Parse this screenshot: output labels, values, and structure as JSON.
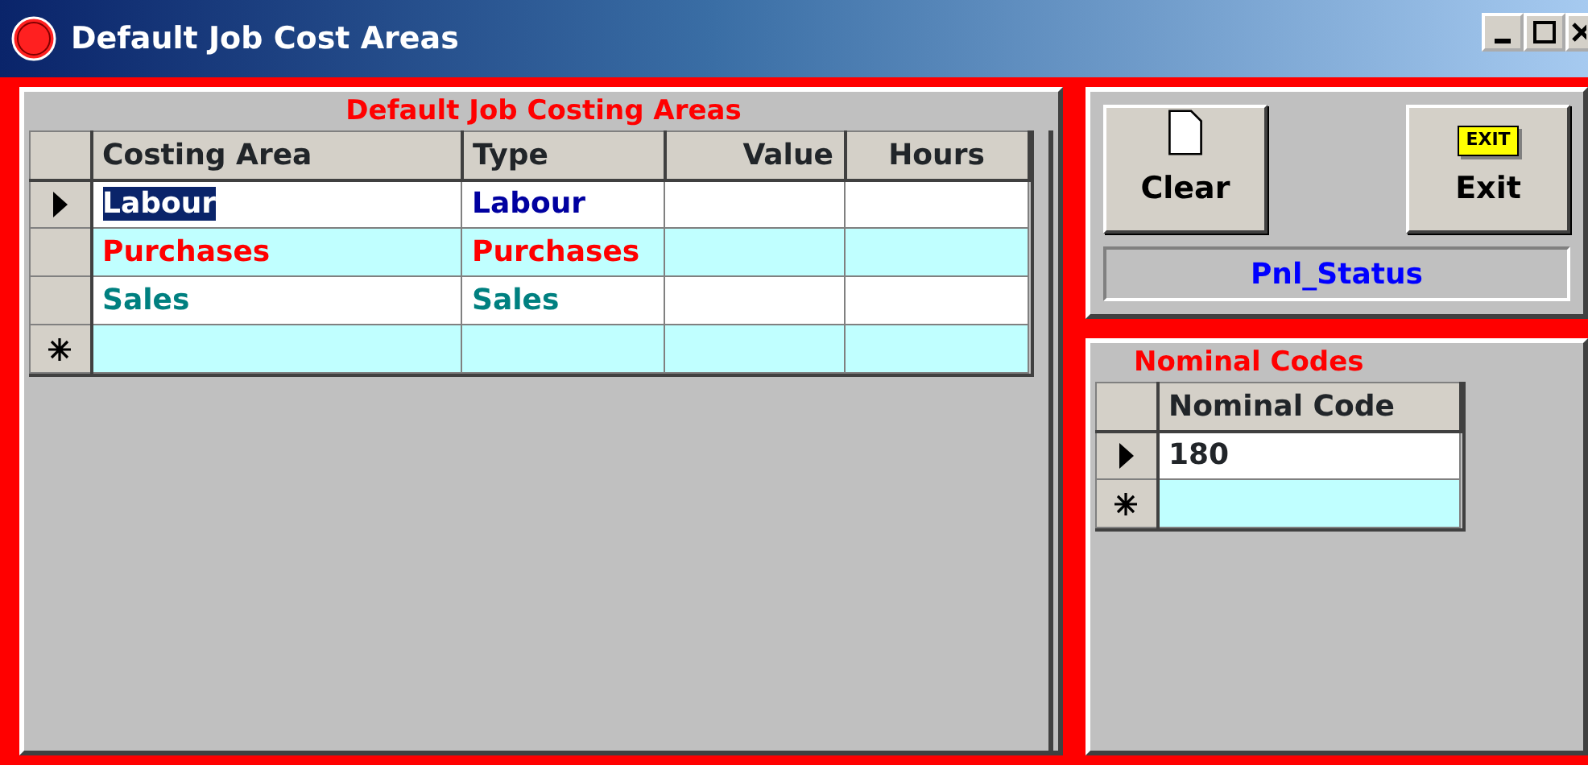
{
  "window": {
    "title": "Default Job Cost Areas"
  },
  "costing_grid": {
    "title": "Default Job Costing Areas",
    "columns": [
      {
        "label": "Costing Area"
      },
      {
        "label": "Type"
      },
      {
        "label": "Value"
      },
      {
        "label": "Hours"
      }
    ],
    "rows": [
      {
        "kind": "current",
        "color": "#0000a0",
        "cells": [
          {
            "text": "Labour",
            "selected": true
          },
          {
            "text": "Labour",
            "selected": false
          }
        ]
      },
      {
        "kind": "normal",
        "color": "#ff0000",
        "cells": [
          {
            "text": "Purchases",
            "selected": false
          },
          {
            "text": "Purchases",
            "selected": false
          }
        ]
      },
      {
        "kind": "normal",
        "color": "#008080",
        "cells": [
          {
            "text": "Sales",
            "selected": false
          },
          {
            "text": "Sales",
            "selected": false
          }
        ]
      },
      {
        "kind": "new",
        "cells": []
      }
    ]
  },
  "buttons": [
    {
      "kind": "clear",
      "label": "Clear"
    },
    {
      "kind": "exit",
      "label": "Exit",
      "icon_text": "EXIT"
    }
  ],
  "status_panel": {
    "text": "Pnl_Status"
  },
  "nominal_grid": {
    "title": "Nominal Codes",
    "columns": [
      {
        "label": "Nominal Code"
      }
    ],
    "rows": [
      {
        "kind": "current",
        "cells": [
          {
            "text": "180",
            "selected": false
          }
        ]
      },
      {
        "kind": "new",
        "cells": []
      }
    ]
  }
}
